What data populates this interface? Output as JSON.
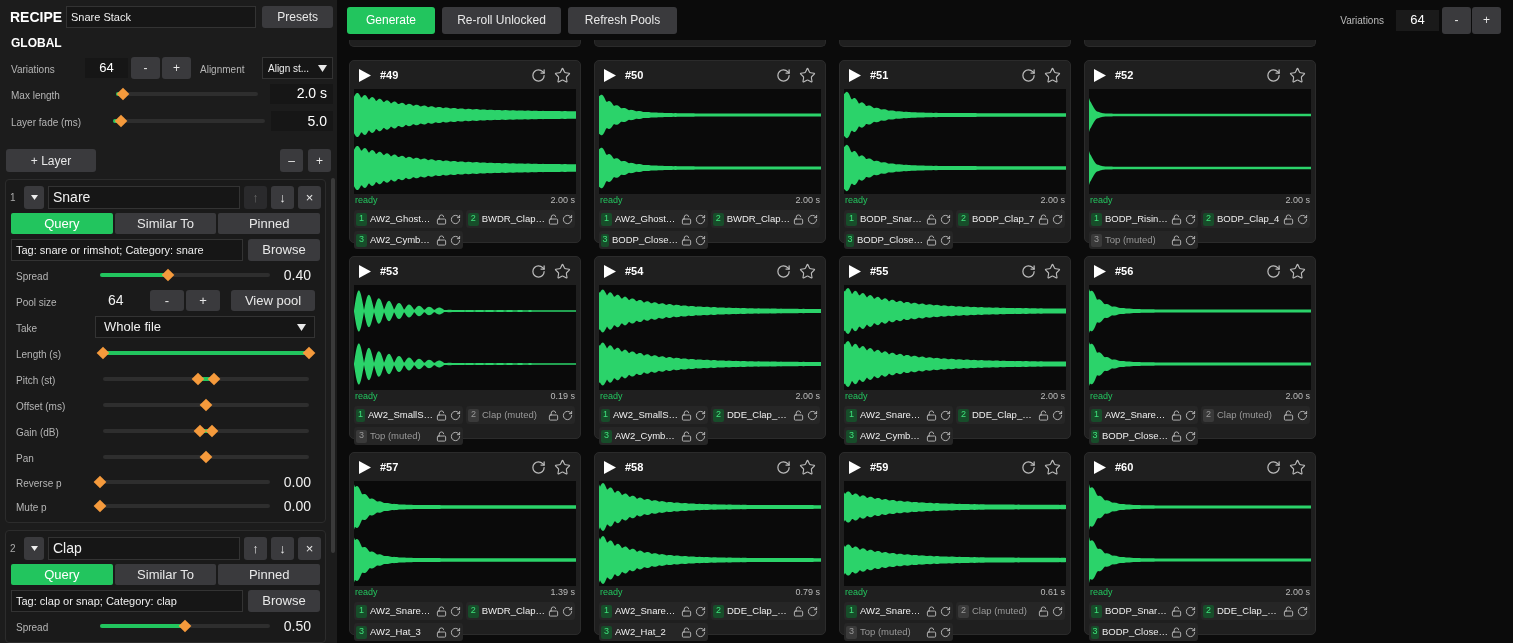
{
  "recipe": {
    "title": "RECIPE",
    "name": "Snare Stack",
    "presets_button": "Presets"
  },
  "global": {
    "title": "GLOBAL",
    "variations": {
      "label": "Variations",
      "value": "64",
      "minus": "-",
      "plus": "+"
    },
    "alignment": {
      "label": "Alignment",
      "value": "Align st..."
    },
    "sliders": [
      {
        "label": "Max length",
        "level": 0.05,
        "value": "2.0 s"
      },
      {
        "label": "Layer fade (ms)",
        "level": 0.05,
        "value": "5.0"
      }
    ]
  },
  "layer_toolbar": {
    "add_button": "+ Layer",
    "minus": "–",
    "plus": "+"
  },
  "layers": [
    {
      "index": "1",
      "name": "Snare",
      "move_up": "↑",
      "move_down": "↓",
      "remove": "×",
      "up_disabled": true,
      "tabs": [
        {
          "label": "Query",
          "selected": true
        },
        {
          "label": "Similar To",
          "selected": false
        },
        {
          "label": "Pinned",
          "selected": false
        }
      ],
      "query": "Tag: snare or rimshot; Category: snare",
      "browse_button": "Browse",
      "controls": [
        {
          "kind": "slider",
          "label": "Spread",
          "level": 0.4,
          "value": "0.40"
        },
        {
          "kind": "stepper",
          "label": "Pool size",
          "value": "64",
          "minus": "-",
          "plus": "+",
          "button": "View pool"
        },
        {
          "kind": "select",
          "label": "Take",
          "value": "Whole file"
        },
        {
          "kind": "range",
          "label": "Length (s)",
          "thumbs": [
            {
              "level": 0
            },
            {
              "level": 1
            }
          ]
        },
        {
          "kind": "range",
          "label": "Pitch (st)",
          "thumbs": [
            {
              "level": 0.46
            },
            {
              "level": 0.54
            }
          ]
        },
        {
          "kind": "range",
          "label": "Offset (ms)",
          "thumbs": [
            {
              "level": 0.5
            }
          ]
        },
        {
          "kind": "range",
          "label": "Gain (dB)",
          "thumbs": [
            {
              "level": 0.47
            },
            {
              "level": 0.53
            }
          ]
        },
        {
          "kind": "range",
          "label": "Pan",
          "thumbs": [
            {
              "level": 0.5
            }
          ]
        },
        {
          "kind": "slider",
          "label": "Reverse p",
          "level": 0,
          "value": "0.00"
        },
        {
          "kind": "slider",
          "label": "Mute p",
          "level": 0,
          "value": "0.00"
        }
      ]
    },
    {
      "index": "2",
      "name": "Clap",
      "move_up": "↑",
      "move_down": "↓",
      "remove": "×",
      "up_disabled": false,
      "tabs": [
        {
          "label": "Query",
          "selected": true
        },
        {
          "label": "Similar To",
          "selected": false
        },
        {
          "label": "Pinned",
          "selected": false
        }
      ],
      "query": "Tag: clap or snap; Category: clap",
      "browse_button": "Browse",
      "controls": [
        {
          "kind": "slider",
          "label": "Spread",
          "level": 0.5,
          "value": "0.50"
        }
      ]
    }
  ],
  "toolbar": {
    "generate_button": "Generate",
    "reroll_button": "Re-roll Unlocked",
    "refresh_button": "Refresh Pools",
    "variations_label": "Variations",
    "variations_value": "64",
    "minus": "-",
    "plus": "+"
  },
  "cards": [
    {
      "number": "#49",
      "status": "ready",
      "duration": "2.00 s",
      "layers": [
        {
          "index": "1",
          "name": "AW2_Ghost…",
          "muted": false
        },
        {
          "index": "2",
          "name": "BWDR_Clap…",
          "muted": false
        },
        {
          "index": "3",
          "name": "AW2_Cymb…",
          "muted": false
        }
      ]
    },
    {
      "number": "#50",
      "status": "ready",
      "duration": "2.00 s",
      "layers": [
        {
          "index": "1",
          "name": "AW2_Ghost…",
          "muted": false
        },
        {
          "index": "2",
          "name": "BWDR_Clap…",
          "muted": false
        },
        {
          "index": "3",
          "name": "BODP_Close…",
          "muted": false
        }
      ]
    },
    {
      "number": "#51",
      "status": "ready",
      "duration": "2.00 s",
      "layers": [
        {
          "index": "1",
          "name": "BODP_Snar…",
          "muted": false
        },
        {
          "index": "2",
          "name": "BODP_Clap_7",
          "muted": false
        },
        {
          "index": "3",
          "name": "BODP_Close…",
          "muted": false
        }
      ]
    },
    {
      "number": "#52",
      "status": "ready",
      "duration": "2.00 s",
      "layers": [
        {
          "index": "1",
          "name": "BODP_Risin…",
          "muted": false
        },
        {
          "index": "2",
          "name": "BODP_Clap_4",
          "muted": false
        },
        {
          "index": "3",
          "name": "Top (muted)",
          "muted": true
        }
      ]
    },
    {
      "number": "#53",
      "status": "ready",
      "duration": "0.19 s",
      "layers": [
        {
          "index": "1",
          "name": "AW2_SmallS…",
          "muted": false
        },
        {
          "index": "2",
          "name": "Clap (muted)",
          "muted": true
        },
        {
          "index": "3",
          "name": "Top (muted)",
          "muted": true
        }
      ]
    },
    {
      "number": "#54",
      "status": "ready",
      "duration": "2.00 s",
      "layers": [
        {
          "index": "1",
          "name": "AW2_SmallS…",
          "muted": false
        },
        {
          "index": "2",
          "name": "DDE_Clap_…",
          "muted": false
        },
        {
          "index": "3",
          "name": "AW2_Cymb…",
          "muted": false
        }
      ]
    },
    {
      "number": "#55",
      "status": "ready",
      "duration": "2.00 s",
      "layers": [
        {
          "index": "1",
          "name": "AW2_Snare…",
          "muted": false
        },
        {
          "index": "2",
          "name": "DDE_Clap_…",
          "muted": false
        },
        {
          "index": "3",
          "name": "AW2_Cymb…",
          "muted": false
        }
      ]
    },
    {
      "number": "#56",
      "status": "ready",
      "duration": "2.00 s",
      "layers": [
        {
          "index": "1",
          "name": "AW2_Snare…",
          "muted": false
        },
        {
          "index": "2",
          "name": "Clap (muted)",
          "muted": true
        },
        {
          "index": "3",
          "name": "BODP_Close…",
          "muted": false
        }
      ]
    },
    {
      "number": "#57",
      "status": "ready",
      "duration": "1.39 s",
      "layers": [
        {
          "index": "1",
          "name": "AW2_Snare…",
          "muted": false
        },
        {
          "index": "2",
          "name": "BWDR_Clap…",
          "muted": false
        },
        {
          "index": "3",
          "name": "AW2_Hat_3",
          "muted": false
        }
      ]
    },
    {
      "number": "#58",
      "status": "ready",
      "duration": "0.79 s",
      "layers": [
        {
          "index": "1",
          "name": "AW2_Snare…",
          "muted": false
        },
        {
          "index": "2",
          "name": "DDE_Clap_…",
          "muted": false
        },
        {
          "index": "3",
          "name": "AW2_Hat_2",
          "muted": false
        }
      ]
    },
    {
      "number": "#59",
      "status": "ready",
      "duration": "0.61 s",
      "layers": [
        {
          "index": "1",
          "name": "AW2_Snare…",
          "muted": false
        },
        {
          "index": "2",
          "name": "Clap (muted)",
          "muted": true
        },
        {
          "index": "3",
          "name": "Top (muted)",
          "muted": true
        }
      ]
    },
    {
      "number": "#60",
      "status": "ready",
      "duration": "2.00 s",
      "layers": [
        {
          "index": "1",
          "name": "BODP_Snar…",
          "muted": false
        },
        {
          "index": "2",
          "name": "DDE_Clap_…",
          "muted": false
        },
        {
          "index": "3",
          "name": "BODP_Close…",
          "muted": false
        }
      ]
    }
  ]
}
